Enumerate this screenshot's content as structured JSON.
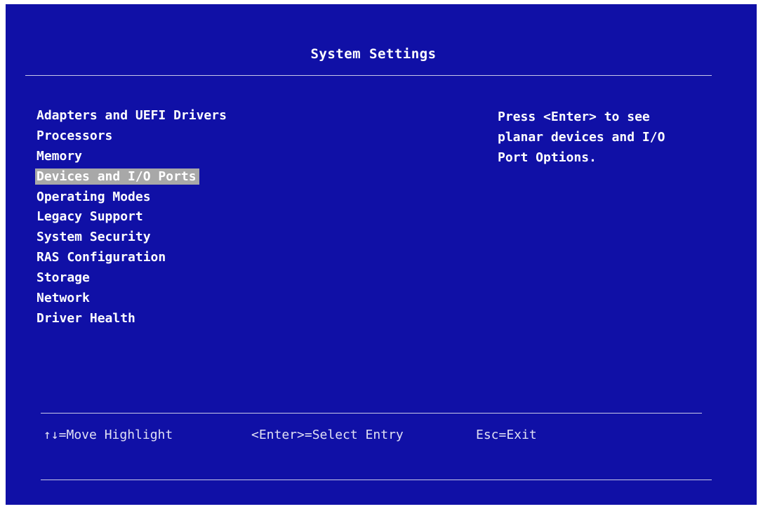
{
  "title": "System Settings",
  "menu": {
    "items": [
      {
        "label": "Adapters and UEFI Drivers"
      },
      {
        "label": "Processors"
      },
      {
        "label": "Memory"
      },
      {
        "label": "Devices and I/O Ports"
      },
      {
        "label": "Operating Modes"
      },
      {
        "label": "Legacy Support"
      },
      {
        "label": "System Security"
      },
      {
        "label": "RAS Configuration"
      },
      {
        "label": "Storage"
      },
      {
        "label": "Network"
      },
      {
        "label": "Driver Health"
      }
    ],
    "selected": "Devices and I/O Ports"
  },
  "help": {
    "lines": [
      "Press <Enter> to see",
      "planar devices and I/O",
      "Port Options."
    ]
  },
  "footer": {
    "move": "↑↓=Move Highlight",
    "select": "<Enter>=Select Entry",
    "exit": "Esc=Exit"
  },
  "colors": {
    "background": "#1010a6",
    "text": "#ffffff",
    "highlight": "#a8a8a8"
  }
}
